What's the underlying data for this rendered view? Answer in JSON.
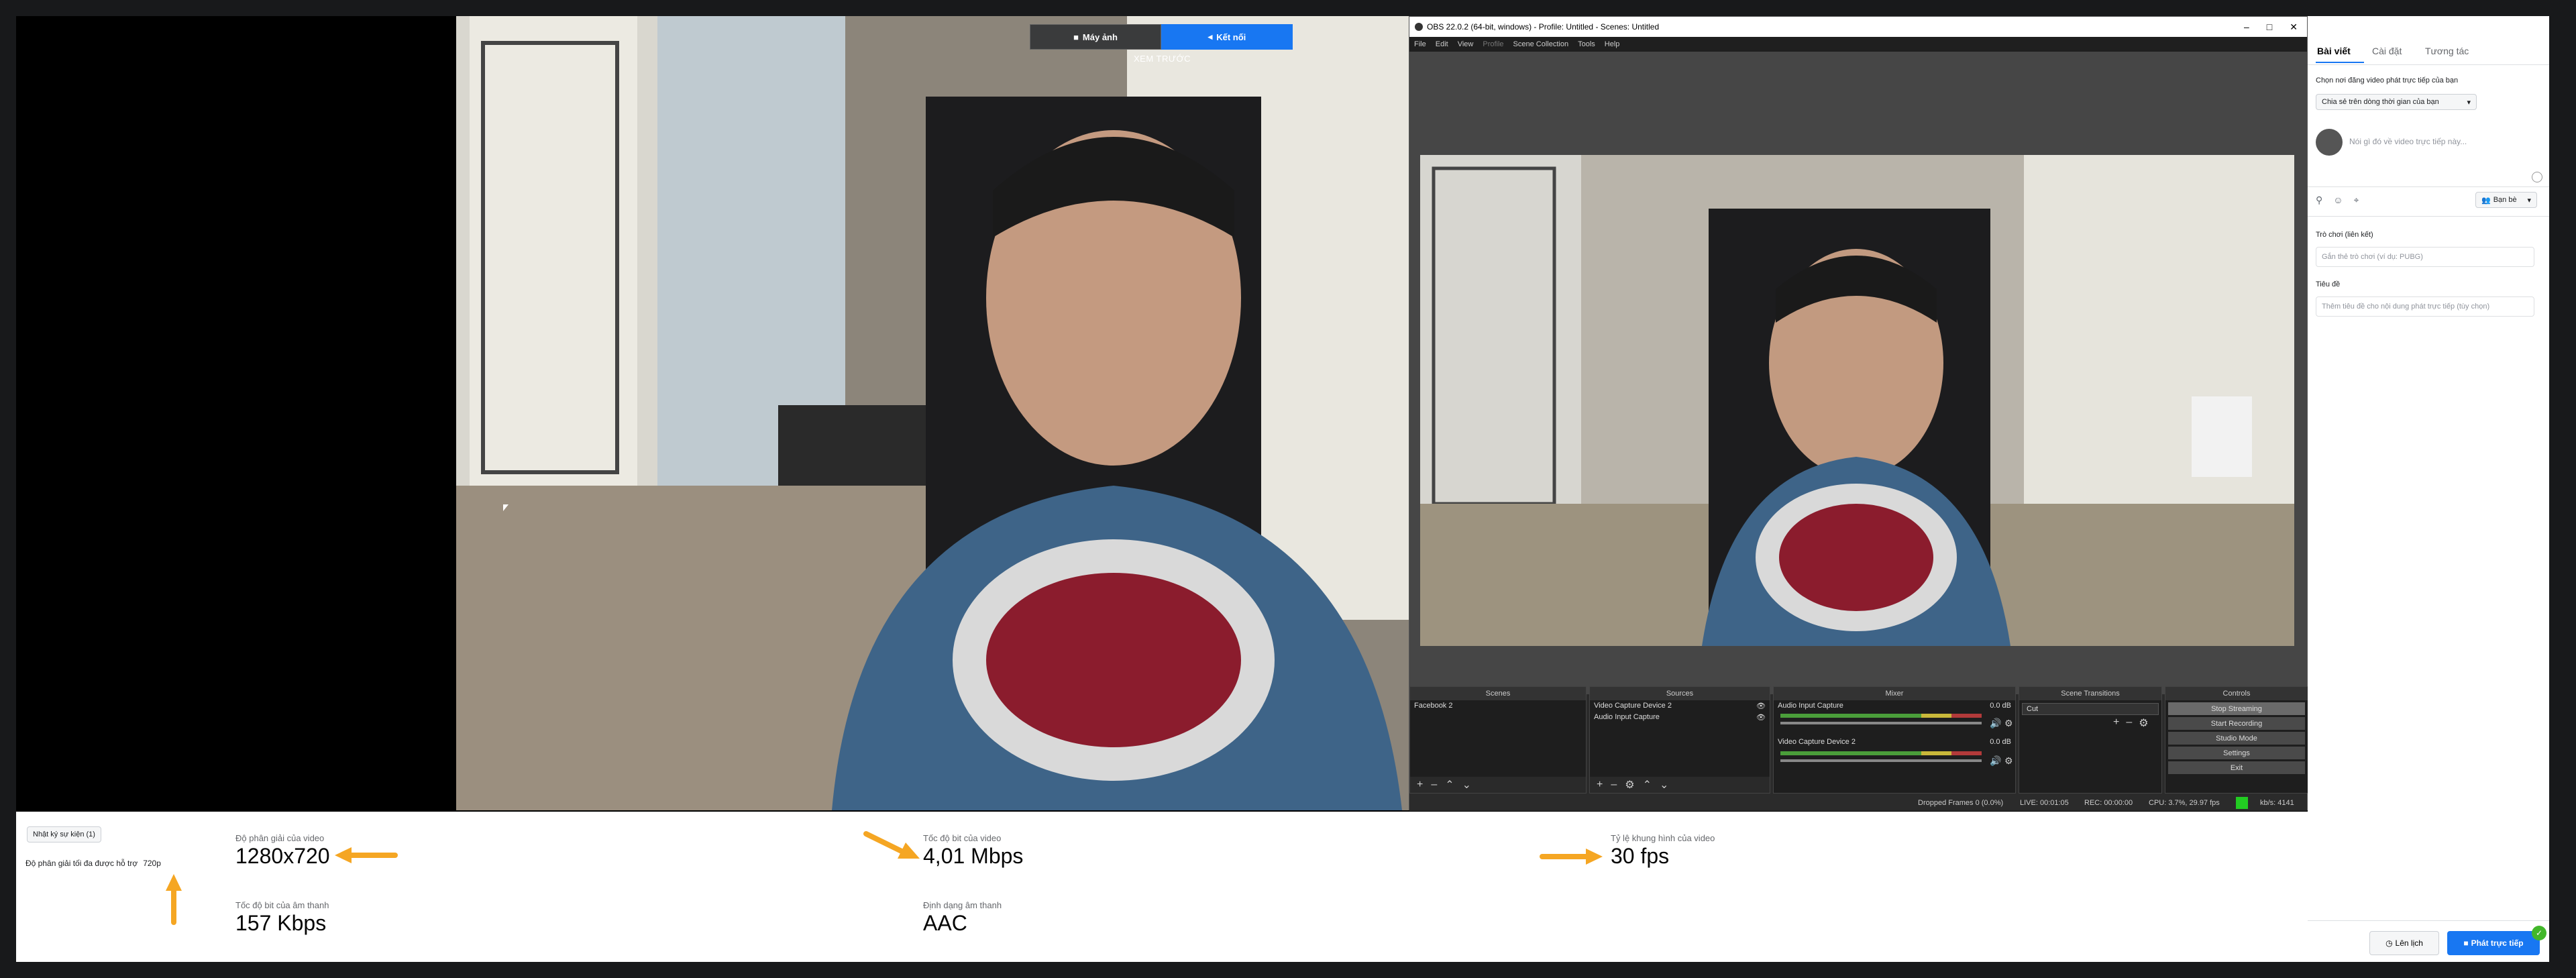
{
  "preview": {
    "camera_button": "Máy ảnh",
    "connect_button": "Kết nối",
    "label": "XEM TRƯỚC"
  },
  "stats": {
    "events_button": "Nhật ký sự kiện (1)",
    "max_res_label": "Độ phân giải tối đa được hỗ trợ",
    "max_res_value": "720p",
    "video_res_label": "Độ phân giải của video",
    "video_res_value": "1280x720",
    "audio_bitrate_label": "Tốc độ bit của âm thanh",
    "audio_bitrate_value": "157 Kbps",
    "video_bitrate_label": "Tốc độ bit của video",
    "video_bitrate_value": "4,01 Mbps",
    "audio_format_label": "Định dạng âm thanh",
    "audio_format_value": "AAC",
    "framerate_label": "Tỷ lệ khung hình của video",
    "framerate_value": "30 fps",
    "arrow_color": "#f5a623"
  },
  "obs": {
    "title": "OBS 22.0.2 (64-bit, windows) - Profile: Untitled - Scenes: Untitled",
    "menu": [
      "File",
      "Edit",
      "View",
      "Profile",
      "Scene Collection",
      "Tools",
      "Help"
    ],
    "docks": {
      "scenes": "Scenes",
      "sources": "Sources",
      "mixer": "Mixer",
      "transitions": "Scene Transitions",
      "controls": "Controls"
    },
    "scenes": [
      "Facebook 2"
    ],
    "sources": [
      "Video Capture Device 2",
      "Audio Input Capture"
    ],
    "mixer": [
      {
        "name": "Audio Input Capture",
        "db": "0.0 dB"
      },
      {
        "name": "Video Capture Device 2",
        "db": "0.0 dB"
      }
    ],
    "transition": "Cut",
    "controls": [
      "Stop Streaming",
      "Start Recording",
      "Studio Mode",
      "Settings",
      "Exit"
    ],
    "status": {
      "dropped": "Dropped Frames 0 (0.0%)",
      "live": "LIVE: 00:01:05",
      "rec": "REC: 00:00:00",
      "cpu": "CPU: 3.7%, 29.97 fps",
      "kbps": "kb/s: 4141"
    }
  },
  "panel": {
    "tabs": [
      "Bài viết",
      "Cài đặt",
      "Tương tác"
    ],
    "post_where_label": "Chọn nơi đăng video phát trực tiếp của bạn",
    "post_where_value": "Chia sẻ trên dòng thời gian của bạn",
    "compose_placeholder": "Nói gì đó về video trực tiếp này...",
    "audience": "Bạn bè",
    "game_label": "Trò chơi (liên kết)",
    "game_placeholder": "Gắn thẻ trò chơi (ví dụ: PUBG)",
    "title_label": "Tiêu đề",
    "title_placeholder": "Thêm tiêu đề cho nội dung phát trực tiếp (tùy chọn)",
    "schedule_button": "Lên lịch",
    "go_live_button": "Phát trực tiếp"
  }
}
